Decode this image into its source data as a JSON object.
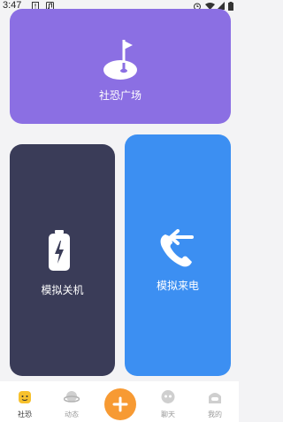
{
  "status_bar": {
    "time": "3:47"
  },
  "cards": {
    "plaza": {
      "label": "社恐广场",
      "icon": "flag-icon",
      "color": "#8b6fe3"
    },
    "shutdown": {
      "label": "模拟关机",
      "icon": "battery-icon",
      "color": "#3a3c58"
    },
    "call": {
      "label": "模拟来电",
      "icon": "incoming-call-icon",
      "color": "#3c8ff2"
    }
  },
  "tabbar": {
    "tabs": [
      {
        "key": "shekong",
        "label": "社恐",
        "icon": "emoji-icon",
        "active": true
      },
      {
        "key": "dongtai",
        "label": "动态",
        "icon": "planet-icon",
        "active": false
      },
      {
        "key": "add",
        "label": "",
        "icon": "plus-icon",
        "active": false
      },
      {
        "key": "liaotian",
        "label": "聊天",
        "icon": "chat-bubble-icon",
        "active": false
      },
      {
        "key": "wode",
        "label": "我的",
        "icon": "profile-icon",
        "active": false
      }
    ],
    "fab_color": "#f79a33"
  }
}
